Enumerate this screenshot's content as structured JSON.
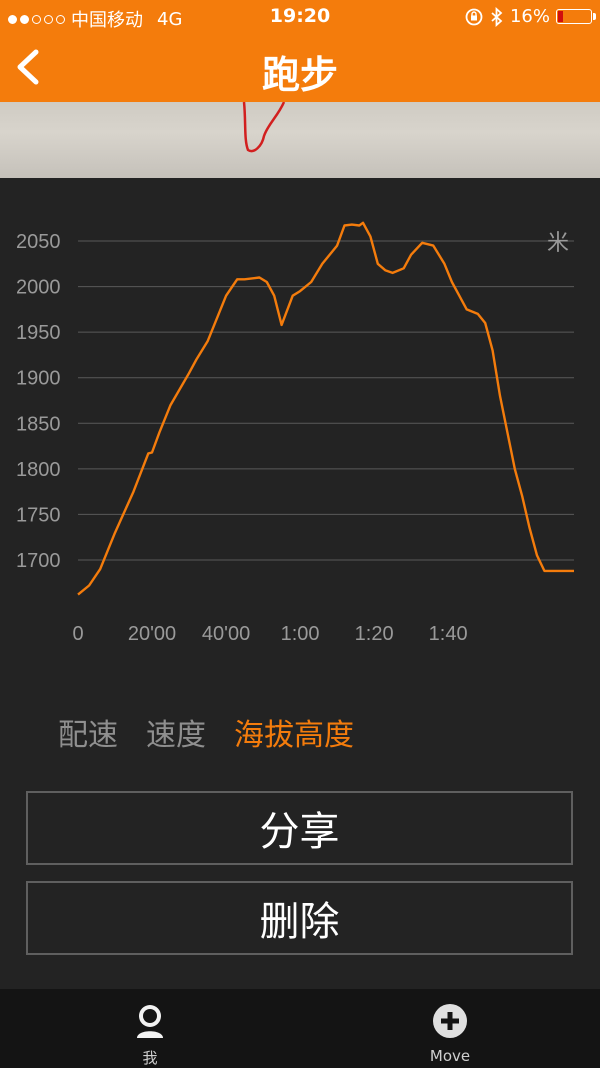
{
  "status_bar": {
    "carrier": "中国移动",
    "network": "4G",
    "time": "19:20",
    "battery": "16%"
  },
  "nav": {
    "title": "跑步"
  },
  "colors": {
    "accent": "#f47c0c",
    "background": "#232323",
    "tabbar": "#141414",
    "route_line": "#d21f1f"
  },
  "chart_data": {
    "type": "line",
    "unit": "米",
    "y_ticks": [
      "2050",
      "2000",
      "1950",
      "1900",
      "1850",
      "1800",
      "1750",
      "1700"
    ],
    "x_ticks": [
      "0",
      "20'00",
      "40'00",
      "1:00",
      "1:20",
      "1:40"
    ],
    "ylim": [
      1655,
      2075
    ],
    "x_range_minutes": [
      0,
      134
    ],
    "grid": true,
    "series": [
      {
        "color": "#f47c0c",
        "x": [
          0,
          3,
          6,
          10,
          15,
          19,
          20,
          22,
          25,
          30,
          32,
          35,
          38,
          40,
          43,
          45,
          49,
          51,
          53,
          55,
          58,
          60,
          63,
          66,
          70,
          72,
          74,
          76,
          77,
          79,
          81,
          83,
          85,
          88,
          90,
          93,
          96,
          99,
          101,
          103,
          105,
          108,
          110,
          112,
          114,
          116,
          118,
          120,
          122,
          124,
          126,
          128,
          130,
          132,
          134
        ],
        "y": [
          1662,
          1672,
          1690,
          1730,
          1775,
          1817,
          1818,
          1840,
          1870,
          1905,
          1920,
          1940,
          1970,
          1990,
          2008,
          2008,
          2010,
          2005,
          1990,
          1958,
          1990,
          1995,
          2005,
          2025,
          2045,
          2067,
          2068,
          2067,
          2070,
          2055,
          2025,
          2018,
          2015,
          2020,
          2035,
          2048,
          2045,
          2025,
          2005,
          1990,
          1975,
          1970,
          1960,
          1930,
          1880,
          1840,
          1800,
          1770,
          1735,
          1705,
          1688,
          1688,
          1688,
          1688,
          1688
        ]
      }
    ]
  },
  "metric_tabs": [
    {
      "label": "配速",
      "active": false
    },
    {
      "label": "速度",
      "active": false
    },
    {
      "label": "海拔高度",
      "active": true
    }
  ],
  "actions": {
    "share": "分享",
    "delete": "删除"
  },
  "tabbar": {
    "me": "我",
    "move": "Move"
  }
}
